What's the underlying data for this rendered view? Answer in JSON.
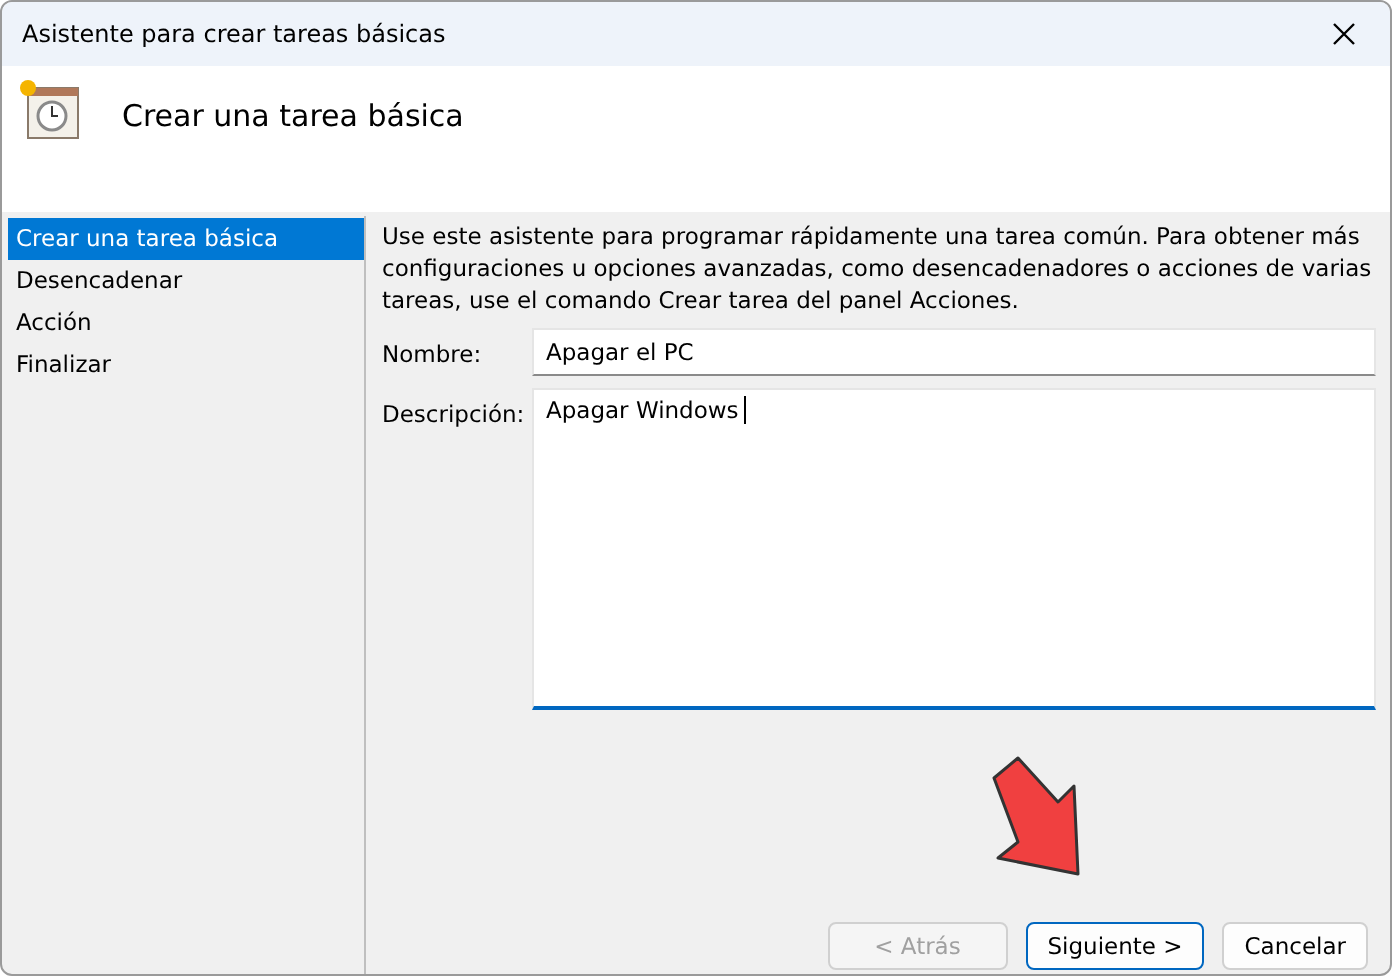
{
  "window": {
    "title": "Asistente para crear tareas básicas"
  },
  "header": {
    "title": "Crear una tarea básica"
  },
  "steps": [
    {
      "label": "Crear una tarea básica",
      "selected": true
    },
    {
      "label": "Desencadenar",
      "selected": false
    },
    {
      "label": "Acción",
      "selected": false
    },
    {
      "label": "Finalizar",
      "selected": false
    }
  ],
  "intro": "Use este asistente para programar rápidamente una tarea común. Para obtener más configuraciones u opciones avanzadas, como desencadenadores o acciones de varias tareas, use el comando Crear tarea del panel Acciones.",
  "fields": [
    {
      "kind": "line",
      "label": "Nombre:",
      "value": "Apagar el PC",
      "focused": false
    },
    {
      "kind": "area",
      "label": "Descripción:",
      "value": "Apagar Windows",
      "focused": true
    }
  ],
  "buttons": [
    {
      "label": "< Atrás",
      "disabled": true,
      "default": false
    },
    {
      "label": "Siguiente >",
      "disabled": false,
      "default": true
    },
    {
      "label": "Cancelar",
      "disabled": false,
      "default": false
    }
  ]
}
